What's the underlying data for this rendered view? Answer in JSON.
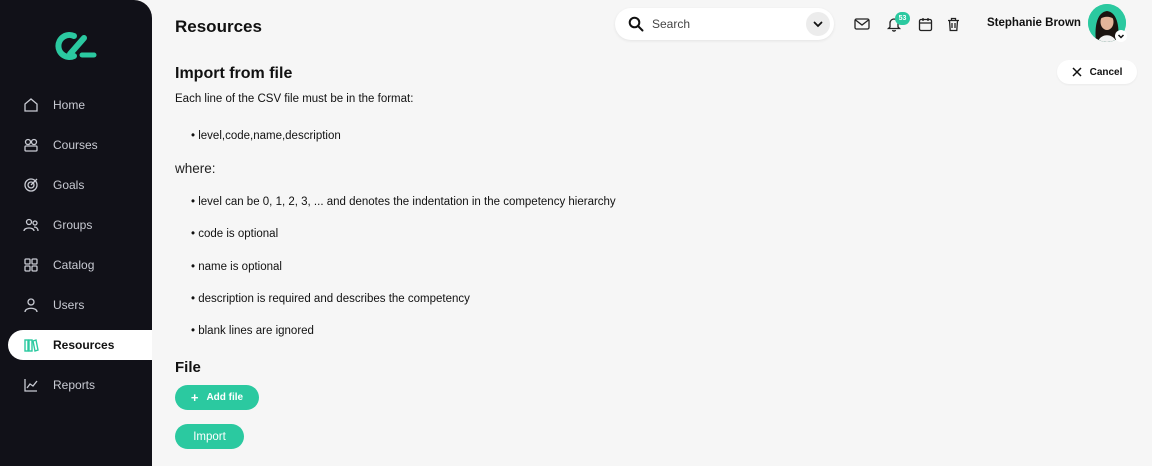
{
  "sidebar": {
    "items": [
      {
        "label": "Home",
        "icon": "home-icon"
      },
      {
        "label": "Courses",
        "icon": "courses-icon"
      },
      {
        "label": "Goals",
        "icon": "goals-icon"
      },
      {
        "label": "Groups",
        "icon": "groups-icon"
      },
      {
        "label": "Catalog",
        "icon": "catalog-icon"
      },
      {
        "label": "Users",
        "icon": "users-icon"
      },
      {
        "label": "Resources",
        "icon": "resources-icon",
        "active": true
      },
      {
        "label": "Reports",
        "icon": "reports-icon"
      }
    ]
  },
  "header": {
    "title": "Resources",
    "search_placeholder": "Search",
    "notification_count": "53",
    "user_name": "Stephanie Brown"
  },
  "content": {
    "section_title": "Import from file",
    "cancel_label": "Cancel",
    "intro": "Each line of the CSV file must be in the format:",
    "format_line": "• level,code,name,description",
    "where": "where:",
    "rules": [
      "• level can be 0, 1, 2, 3, ... and denotes the indentation in the competency hierarchy",
      "• code is optional",
      "• name is optional",
      "• description is required and describes the competency",
      "• blank lines are ignored"
    ],
    "file_title": "File",
    "add_file_label": "Add file",
    "import_label": "Import"
  },
  "colors": {
    "accent": "#2bc9a0",
    "sidebar_bg": "#111118",
    "page_bg": "#f6f6f6"
  }
}
